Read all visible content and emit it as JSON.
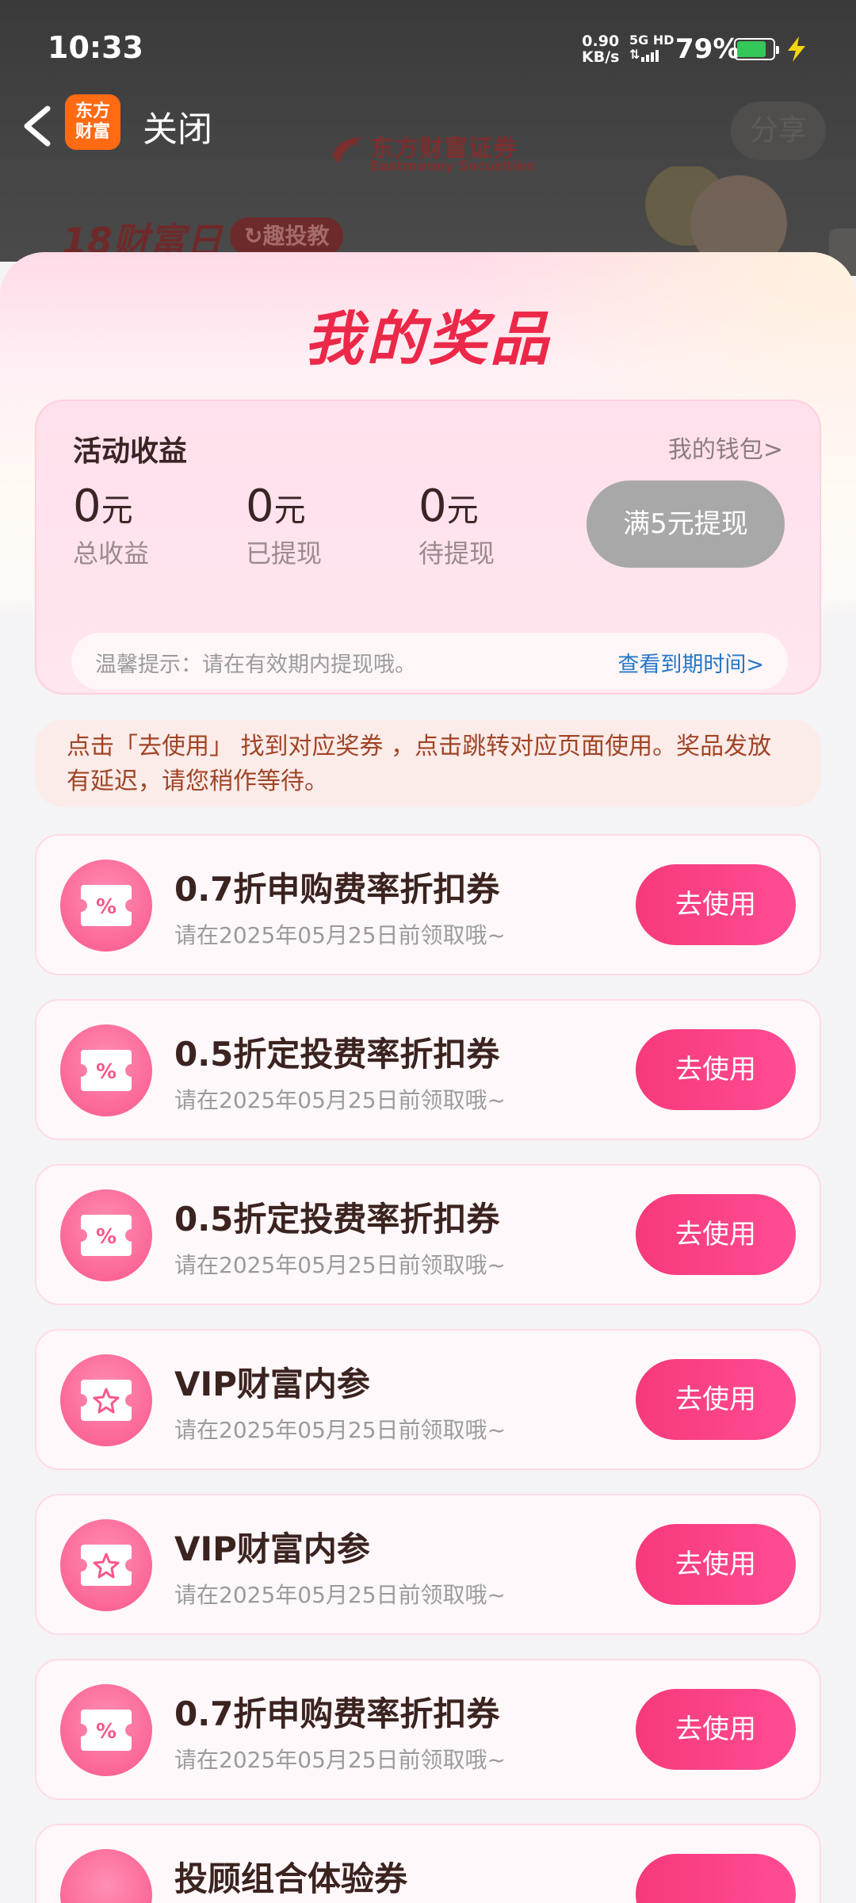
{
  "status_bar": {
    "time": "10:33",
    "net_speed_value": "0.90",
    "net_speed_unit": "KB/s",
    "network": "5G HD",
    "battery_percent": "79%",
    "battery_level": 0.79,
    "battery_color": "#34c759"
  },
  "background_page": {
    "brand_cn": "东方财富证券",
    "brand_en": "Eastmoney Securities",
    "banner_left": "18财富日",
    "banner_pill": "趣投教",
    "share_label": "分享"
  },
  "nav": {
    "app_logo_line1": "东方",
    "app_logo_line2": "财富",
    "close_label": "关闭"
  },
  "sheet": {
    "title": "我的奖品",
    "earnings": {
      "title": "活动收益",
      "wallet_link": "我的钱包>",
      "stats": [
        {
          "value": "0",
          "unit": "元",
          "label": "总收益"
        },
        {
          "value": "0",
          "unit": "元",
          "label": "已提现"
        },
        {
          "value": "0",
          "unit": "元",
          "label": "待提现"
        }
      ],
      "withdraw_button": "满5元提现",
      "tip_text": "温馨提示：请在有效期内提现哦。",
      "tip_link": "查看到期时间>"
    },
    "notice": "点击「去使用」 找到对应奖券 ，点击跳转对应页面使用。奖品发放有延迟，请您稍作等待。",
    "prizes": [
      {
        "name": "0.7折申购费率折扣券",
        "date": "请在2025年05月25日前领取哦~",
        "icon": "percent-coupon-icon",
        "button": "去使用"
      },
      {
        "name": "0.5折定投费率折扣券",
        "date": "请在2025年05月25日前领取哦~",
        "icon": "percent-coupon-icon",
        "button": "去使用"
      },
      {
        "name": "0.5折定投费率折扣券",
        "date": "请在2025年05月25日前领取哦~",
        "icon": "percent-coupon-icon",
        "button": "去使用"
      },
      {
        "name": "VIP财富内参",
        "date": "请在2025年05月25日前领取哦~",
        "icon": "star-coupon-icon",
        "button": "去使用"
      },
      {
        "name": "VIP财富内参",
        "date": "请在2025年05月25日前领取哦~",
        "icon": "star-coupon-icon",
        "button": "去使用"
      },
      {
        "name": "0.7折申购费率折扣券",
        "date": "请在2025年05月25日前领取哦~",
        "icon": "percent-coupon-icon",
        "button": "去使用"
      },
      {
        "name": "投顾组合体验券",
        "date": "",
        "icon": "percent-coupon-icon",
        "button": ""
      }
    ]
  },
  "colors": {
    "accent": "#ec2849",
    "button": "#f7397c",
    "notice_text": "#a04425",
    "link": "#2577c9"
  }
}
